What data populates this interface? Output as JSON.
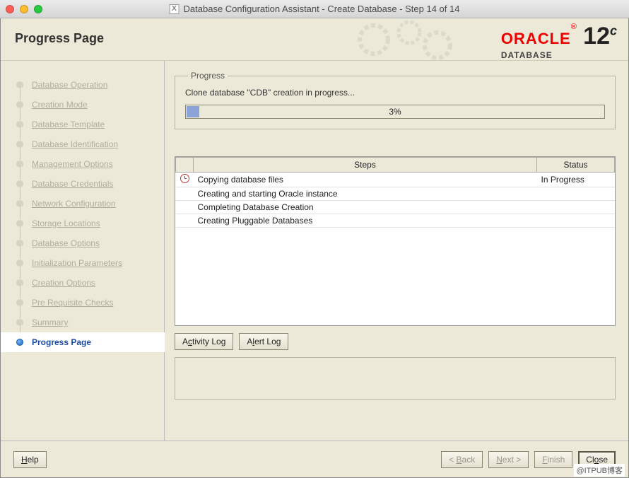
{
  "window": {
    "title": "Database Configuration Assistant - Create Database - Step 14 of 14"
  },
  "header": {
    "page_title": "Progress Page",
    "brand": "ORACLE",
    "brand_sub": "DATABASE",
    "version": "12",
    "version_suffix": "c"
  },
  "sidebar": {
    "items": [
      {
        "label": "Database Operation"
      },
      {
        "label": "Creation Mode"
      },
      {
        "label": "Database Template"
      },
      {
        "label": "Database Identification"
      },
      {
        "label": "Management Options"
      },
      {
        "label": "Database Credentials"
      },
      {
        "label": "Network Configuration"
      },
      {
        "label": "Storage Locations"
      },
      {
        "label": "Database Options"
      },
      {
        "label": "Initialization Parameters"
      },
      {
        "label": "Creation Options"
      },
      {
        "label": "Pre Requisite Checks"
      },
      {
        "label": "Summary"
      },
      {
        "label": "Progress Page",
        "active": true
      }
    ]
  },
  "progress": {
    "legend": "Progress",
    "message": "Clone database \"CDB\" creation in progress...",
    "percent": 3,
    "percent_label": "3%"
  },
  "steps_table": {
    "col_steps": "Steps",
    "col_status": "Status",
    "rows": [
      {
        "name": "Copying database files",
        "status": "In Progress",
        "icon": "clock"
      },
      {
        "name": "Creating and starting Oracle instance",
        "status": "",
        "icon": ""
      },
      {
        "name": "Completing Database Creation",
        "status": "",
        "icon": ""
      },
      {
        "name": "Creating Pluggable Databases",
        "status": "",
        "icon": ""
      }
    ]
  },
  "buttons": {
    "activity_log_pre": "A",
    "activity_log_u": "c",
    "activity_log_post": "tivity Log",
    "alert_log_pre": "A",
    "alert_log_u": "l",
    "alert_log_post": "ert Log",
    "help_u": "H",
    "help_post": "elp",
    "back_pre": "< ",
    "back_u": "B",
    "back_post": "ack",
    "next_u": "N",
    "next_post": "ext >",
    "finish_u": "F",
    "finish_post": "inish",
    "close_pre": "Cl",
    "close_u": "o",
    "close_post": "se"
  },
  "watermark": "@ITPUB博客"
}
